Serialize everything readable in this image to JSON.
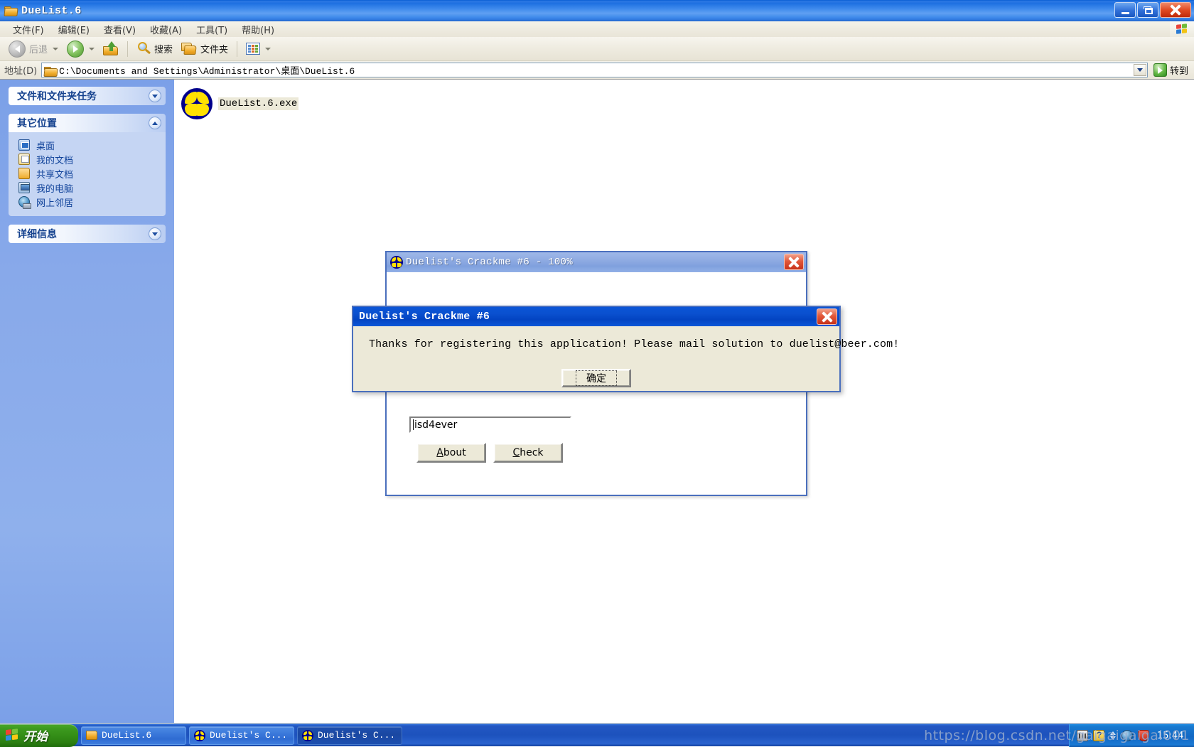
{
  "explorer": {
    "title": "DueList.6",
    "title_icon": "folder-icon",
    "caption": {
      "minimize": "minimize-button",
      "maximize": "maximize-button",
      "close": "close-button"
    },
    "menu": [
      {
        "label": "文件(F)"
      },
      {
        "label": "编辑(E)"
      },
      {
        "label": "查看(V)"
      },
      {
        "label": "收藏(A)"
      },
      {
        "label": "工具(T)"
      },
      {
        "label": "帮助(H)"
      }
    ],
    "toolbar": {
      "back": "后退",
      "forward": "",
      "up": "",
      "search": "搜索",
      "folders": "文件夹",
      "views": ""
    },
    "address": {
      "label": "地址(D)",
      "value": "C:\\Documents and Settings\\Administrator\\桌面\\DueList.6",
      "go_label": "转到"
    },
    "sidebar": {
      "panels": [
        {
          "title": "文件和文件夹任务",
          "state": "collapsed",
          "items": []
        },
        {
          "title": "其它位置",
          "state": "expanded",
          "items": [
            {
              "label": "桌面",
              "icon": "desktop-icon"
            },
            {
              "label": "我的文档",
              "icon": "my-documents-icon"
            },
            {
              "label": "共享文档",
              "icon": "shared-documents-icon"
            },
            {
              "label": "我的电脑",
              "icon": "my-computer-icon"
            },
            {
              "label": "网上邻居",
              "icon": "network-places-icon"
            }
          ]
        },
        {
          "title": "详细信息",
          "state": "collapsed",
          "items": []
        }
      ]
    },
    "files": [
      {
        "name": "DueList.6.exe",
        "icon": "exe-flower-icon",
        "selected": true
      }
    ]
  },
  "crackme_window": {
    "title": "Duelist's Crackme #6 - 100%",
    "icon": "exe-flower-icon",
    "close": "close-button",
    "serial_input": {
      "value": "isd4ever",
      "placeholder": ""
    },
    "buttons": [
      {
        "label": "About",
        "accel": "A"
      },
      {
        "label": "Check",
        "accel": "C"
      }
    ]
  },
  "message_box": {
    "title": "Duelist's Crackme #6",
    "message": "Thanks for registering this application! Please mail solution to duelist@beer.com!",
    "ok_label": "确定",
    "close": "close-button"
  },
  "taskbar": {
    "start_label": "开始",
    "tasks": [
      {
        "label": "DueList.6",
        "icon": "folder-icon",
        "active": false
      },
      {
        "label": "Duelist's C...",
        "icon": "exe-flower-icon",
        "active": false
      },
      {
        "label": "Duelist's C...",
        "icon": "exe-flower-icon",
        "active": true
      }
    ],
    "tray": {
      "icons": [
        "keyboard-icon",
        "notes-icon",
        "updown-icon",
        "network-icon",
        "shield-icon"
      ],
      "clock": "15:44"
    }
  },
  "watermark": {
    "text": "https://blog.csdn.net/gaigaigaigai001"
  }
}
